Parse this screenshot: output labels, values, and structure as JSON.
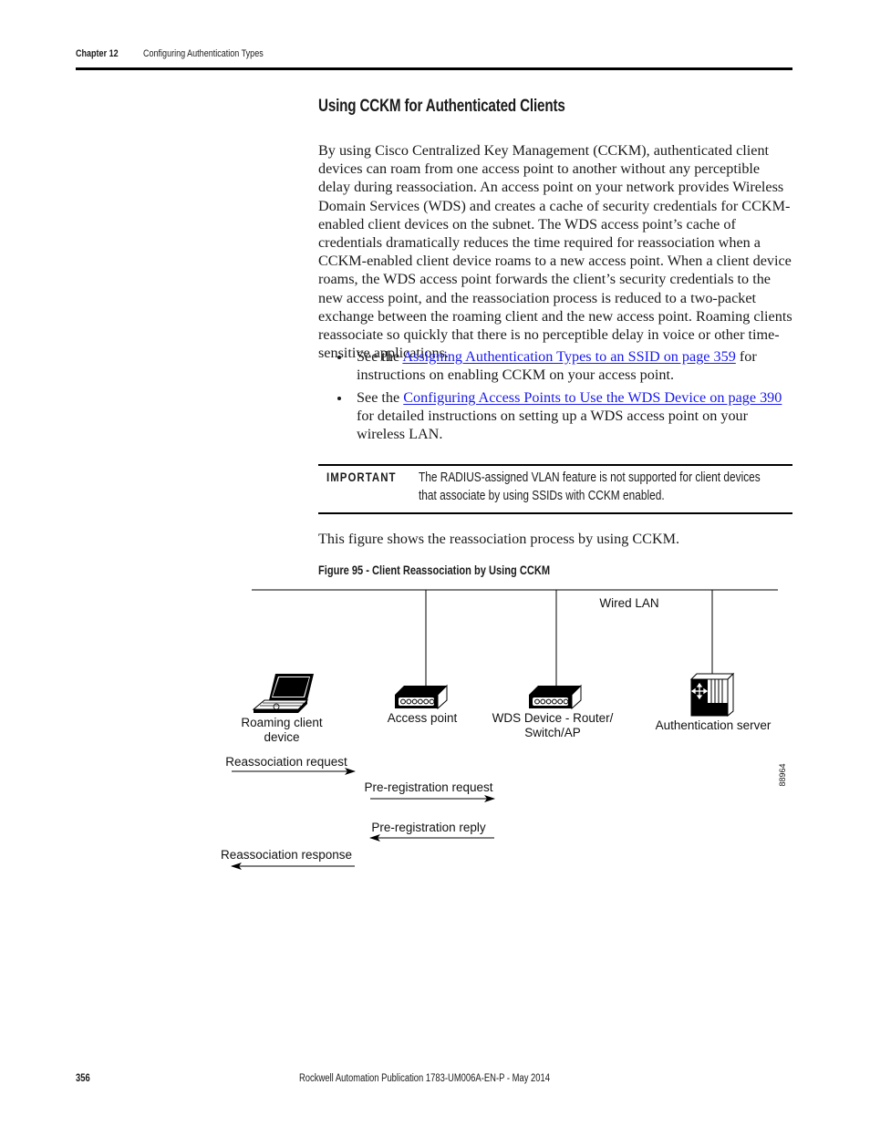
{
  "header": {
    "chapter": "Chapter 12",
    "title": "Configuring Authentication Types"
  },
  "section": {
    "title": "Using CCKM for Authenticated Clients",
    "intro": "By using Cisco Centralized Key Management (CCKM), authenticated client devices can roam from one access point to another without any perceptible delay during reassociation. An access point on your network provides Wireless Domain Services (WDS) and creates a cache of security credentials for CCKM-enabled client devices on the subnet. The WDS access point’s cache of credentials dramatically reduces the time required for reassociation when a CCKM-enabled client device roams to a new access point. When a client device roams, the WDS access point forwards the client’s security credentials to the new access point, and the reassociation process is reduced to a two-packet exchange between the roaming client and the new access point. Roaming clients reassociate so quickly that there is no perceptible delay in voice or other time-sensitive applications.",
    "bullets": [
      {
        "prefix": "See the ",
        "link": "Assigning Authentication Types to an SSID on page 359",
        "suffix": " for instructions on enabling CCKM on your access point."
      },
      {
        "prefix": "See the ",
        "link": "Configuring Access Points to Use the WDS Device on page 390",
        "suffix": " for detailed instructions on setting up a WDS access point on your wireless LAN."
      }
    ]
  },
  "important": {
    "label": "IMPORTANT",
    "text": "The RADIUS-assigned VLAN feature is not supported for client devices that associate by using SSIDs with CCKM enabled."
  },
  "figure": {
    "intro": "This figure shows the reassociation process by using CCKM.",
    "caption": "Figure 95 - Client Reassociation by Using CCKM",
    "network_label": "Wired LAN",
    "devices": {
      "client": [
        "Roaming client",
        "device"
      ],
      "access_point": "Access point",
      "wds": [
        "WDS Device - Router/",
        "Switch/AP"
      ],
      "auth_server": "Authentication server"
    },
    "messages": {
      "reassoc_request": "Reassociation request",
      "prereg_request": "Pre-registration request",
      "prereg_reply": "Pre-registration reply",
      "reassoc_response": "Reassociation response"
    },
    "figure_id": "88964"
  },
  "footer": {
    "page_number": "356",
    "publication": "Rockwell Automation Publication 1783-UM006A-EN-P - May 2014"
  },
  "colors": {
    "link": "#1a1aee",
    "rule": "#000000"
  }
}
